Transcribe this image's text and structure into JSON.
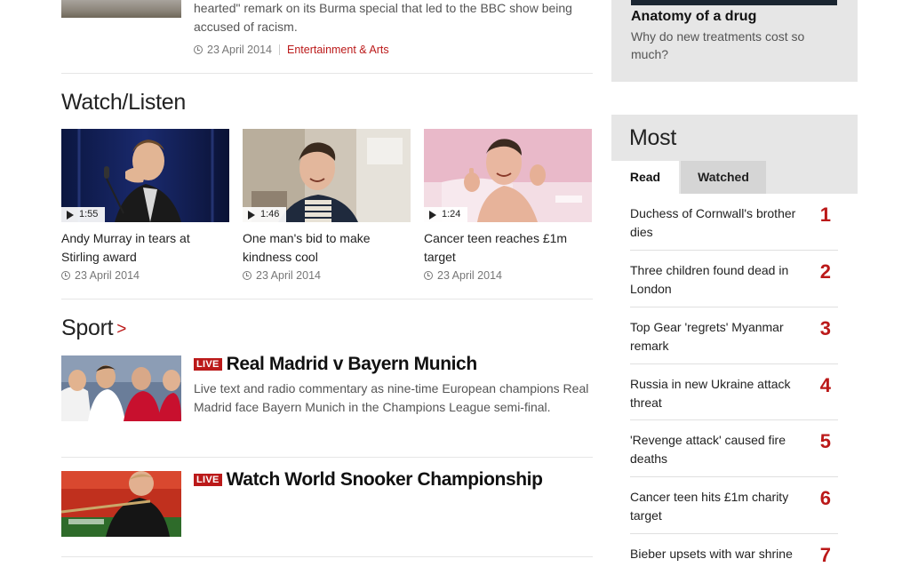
{
  "top_story": {
    "summary": "hearted\" remark on its Burma special that led to the BBC show being accused of racism.",
    "date": "23 April 2014",
    "section": "Entertainment & Arts"
  },
  "watch_listen": {
    "title": "Watch/Listen",
    "videos": [
      {
        "duration": "1:55",
        "title": "Andy Murray in tears at Stirling award",
        "date": "23 April 2014"
      },
      {
        "duration": "1:46",
        "title": "One man's bid to make kindness cool",
        "date": "23 April 2014"
      },
      {
        "duration": "1:24",
        "title": "Cancer teen reaches £1m target",
        "date": "23 April 2014"
      }
    ]
  },
  "sport": {
    "title": "Sport",
    "chevron": ">",
    "stories": [
      {
        "badge": "LIVE",
        "headline": "Real Madrid v Bayern Munich",
        "summary": "Live text and radio commentary as nine-time European champions Real Madrid face Bayern Munich in the Champions League semi-final."
      },
      {
        "badge": "LIVE",
        "headline": "Watch World Snooker Championship"
      }
    ]
  },
  "feature": {
    "title": "Anatomy of a drug",
    "summary": "Why do new treatments cost so much?"
  },
  "most": {
    "title": "Most",
    "tabs": [
      "Read",
      "Watched"
    ],
    "items": [
      {
        "rank": "1",
        "title": "Duchess of Cornwall's brother dies"
      },
      {
        "rank": "2",
        "title": "Three children found dead in London"
      },
      {
        "rank": "3",
        "title": "Top Gear 'regrets' Myanmar remark"
      },
      {
        "rank": "4",
        "title": "Russia in new Ukraine attack threat"
      },
      {
        "rank": "5",
        "title": "'Revenge attack' caused fire deaths"
      },
      {
        "rank": "6",
        "title": "Cancer teen hits £1m charity target"
      },
      {
        "rank": "7",
        "title": "Bieber upsets with war shrine"
      }
    ]
  },
  "colors": {
    "accent": "#bb1919",
    "panel": "#e6e6e6",
    "text": "#222222"
  }
}
